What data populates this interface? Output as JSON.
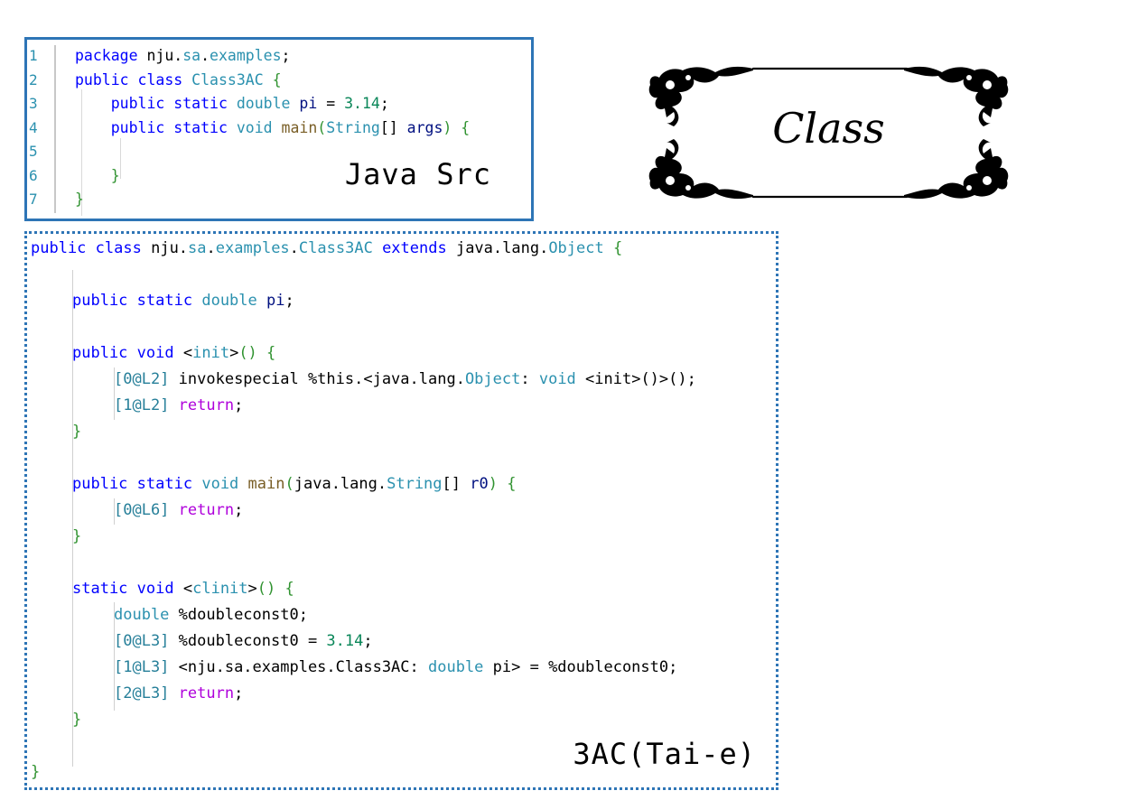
{
  "java_src": {
    "label": "Java Src",
    "lines": [
      {
        "num": "1",
        "tokens": [
          [
            "kw",
            "package"
          ],
          [
            "pl",
            " nju."
          ],
          [
            "ty",
            "sa"
          ],
          [
            "pl",
            "."
          ],
          [
            "ty",
            "examples"
          ],
          [
            "pl",
            ";"
          ]
        ]
      },
      {
        "num": "2",
        "tokens": [
          [
            "kw",
            "public"
          ],
          [
            "pl",
            " "
          ],
          [
            "kw",
            "class"
          ],
          [
            "pl",
            " "
          ],
          [
            "ty",
            "Class3AC"
          ],
          [
            "pl",
            " "
          ],
          [
            "br",
            "{"
          ]
        ]
      },
      {
        "num": "3",
        "tokens": [
          [
            "pl",
            "    "
          ],
          [
            "kw",
            "public"
          ],
          [
            "pl",
            " "
          ],
          [
            "kw",
            "static"
          ],
          [
            "pl",
            " "
          ],
          [
            "ty",
            "double"
          ],
          [
            "pl",
            " "
          ],
          [
            "var",
            "pi"
          ],
          [
            "pl",
            " = "
          ],
          [
            "num",
            "3.14"
          ],
          [
            "pl",
            ";"
          ]
        ]
      },
      {
        "num": "4",
        "tokens": [
          [
            "pl",
            "    "
          ],
          [
            "kw",
            "public"
          ],
          [
            "pl",
            " "
          ],
          [
            "kw",
            "static"
          ],
          [
            "pl",
            " "
          ],
          [
            "ty",
            "void"
          ],
          [
            "pl",
            " "
          ],
          [
            "fn",
            "main"
          ],
          [
            "br",
            "("
          ],
          [
            "ty",
            "String"
          ],
          [
            "pl",
            "[] "
          ],
          [
            "var",
            "args"
          ],
          [
            "br",
            ")"
          ],
          [
            "pl",
            " "
          ],
          [
            "br",
            "{"
          ]
        ]
      },
      {
        "num": "5",
        "tokens": []
      },
      {
        "num": "6",
        "tokens": [
          [
            "pl",
            "    "
          ],
          [
            "br",
            "}"
          ]
        ]
      },
      {
        "num": "7",
        "tokens": [
          [
            "br",
            "}"
          ]
        ]
      }
    ]
  },
  "banner": {
    "title": "Class"
  },
  "tac": {
    "label": "3AC(Tai-e)",
    "lines": [
      {
        "indent": 0,
        "tokens": [
          [
            "kw",
            "public"
          ],
          [
            "pl",
            " "
          ],
          [
            "kw",
            "class"
          ],
          [
            "pl",
            " nju."
          ],
          [
            "ty",
            "sa"
          ],
          [
            "pl",
            "."
          ],
          [
            "ty",
            "examples"
          ],
          [
            "pl",
            "."
          ],
          [
            "ty",
            "Class3AC"
          ],
          [
            "pl",
            " "
          ],
          [
            "kw",
            "extends"
          ],
          [
            "pl",
            " java.lang."
          ],
          [
            "ty",
            "Object"
          ],
          [
            "pl",
            " "
          ],
          [
            "br",
            "{"
          ]
        ]
      },
      {
        "indent": 0,
        "tokens": []
      },
      {
        "indent": 1,
        "tokens": [
          [
            "kw",
            "public"
          ],
          [
            "pl",
            " "
          ],
          [
            "kw",
            "static"
          ],
          [
            "pl",
            " "
          ],
          [
            "ty",
            "double"
          ],
          [
            "pl",
            " "
          ],
          [
            "var",
            "pi"
          ],
          [
            "pl",
            ";"
          ]
        ]
      },
      {
        "indent": 0,
        "tokens": []
      },
      {
        "indent": 1,
        "tokens": [
          [
            "kw",
            "public"
          ],
          [
            "pl",
            " "
          ],
          [
            "kw",
            "void"
          ],
          [
            "pl",
            " <"
          ],
          [
            "ty",
            "init"
          ],
          [
            "pl",
            ">"
          ],
          [
            "br",
            "()"
          ],
          [
            "pl",
            " "
          ],
          [
            "br",
            "{"
          ]
        ]
      },
      {
        "indent": 2,
        "tokens": [
          [
            "lbl",
            "[0@L2]"
          ],
          [
            "pl",
            " invokespecial %this.<java.lang."
          ],
          [
            "ty",
            "Object"
          ],
          [
            "pl",
            ": "
          ],
          [
            "ty",
            "void"
          ],
          [
            "pl",
            " <init>()>();"
          ]
        ]
      },
      {
        "indent": 2,
        "tokens": [
          [
            "lbl",
            "[1@L2]"
          ],
          [
            "pl",
            " "
          ],
          [
            "ret",
            "return"
          ],
          [
            "pl",
            ";"
          ]
        ]
      },
      {
        "indent": 1,
        "tokens": [
          [
            "br",
            "}"
          ]
        ]
      },
      {
        "indent": 0,
        "tokens": []
      },
      {
        "indent": 1,
        "tokens": [
          [
            "kw",
            "public"
          ],
          [
            "pl",
            " "
          ],
          [
            "kw",
            "static"
          ],
          [
            "pl",
            " "
          ],
          [
            "ty",
            "void"
          ],
          [
            "pl",
            " "
          ],
          [
            "fn",
            "main"
          ],
          [
            "br",
            "("
          ],
          [
            "pl",
            "java.lang."
          ],
          [
            "ty",
            "String"
          ],
          [
            "pl",
            "[] "
          ],
          [
            "var",
            "r0"
          ],
          [
            "br",
            ")"
          ],
          [
            "pl",
            " "
          ],
          [
            "br",
            "{"
          ]
        ]
      },
      {
        "indent": 2,
        "tokens": [
          [
            "lbl",
            "[0@L6]"
          ],
          [
            "pl",
            " "
          ],
          [
            "ret",
            "return"
          ],
          [
            "pl",
            ";"
          ]
        ]
      },
      {
        "indent": 1,
        "tokens": [
          [
            "br",
            "}"
          ]
        ]
      },
      {
        "indent": 0,
        "tokens": []
      },
      {
        "indent": 1,
        "tokens": [
          [
            "kw",
            "static"
          ],
          [
            "pl",
            " "
          ],
          [
            "kw",
            "void"
          ],
          [
            "pl",
            " <"
          ],
          [
            "ty",
            "clinit"
          ],
          [
            "pl",
            ">"
          ],
          [
            "br",
            "()"
          ],
          [
            "pl",
            " "
          ],
          [
            "br",
            "{"
          ]
        ]
      },
      {
        "indent": 2,
        "tokens": [
          [
            "ty",
            "double"
          ],
          [
            "pl",
            " %doubleconst0;"
          ]
        ]
      },
      {
        "indent": 2,
        "tokens": [
          [
            "lbl",
            "[0@L3]"
          ],
          [
            "pl",
            " %doubleconst0 = "
          ],
          [
            "num",
            "3.14"
          ],
          [
            "pl",
            ";"
          ]
        ]
      },
      {
        "indent": 2,
        "tokens": [
          [
            "lbl",
            "[1@L3]"
          ],
          [
            "pl",
            " <nju.sa.examples.Class3AC: "
          ],
          [
            "ty",
            "double"
          ],
          [
            "pl",
            " pi> = %doubleconst0;"
          ]
        ]
      },
      {
        "indent": 2,
        "tokens": [
          [
            "lbl",
            "[2@L3]"
          ],
          [
            "pl",
            " "
          ],
          [
            "ret",
            "return"
          ],
          [
            "pl",
            ";"
          ]
        ]
      },
      {
        "indent": 1,
        "tokens": [
          [
            "br",
            "}"
          ]
        ]
      },
      {
        "indent": 0,
        "tokens": []
      },
      {
        "indent": 0,
        "tokens": [
          [
            "br",
            "}"
          ]
        ]
      }
    ]
  }
}
